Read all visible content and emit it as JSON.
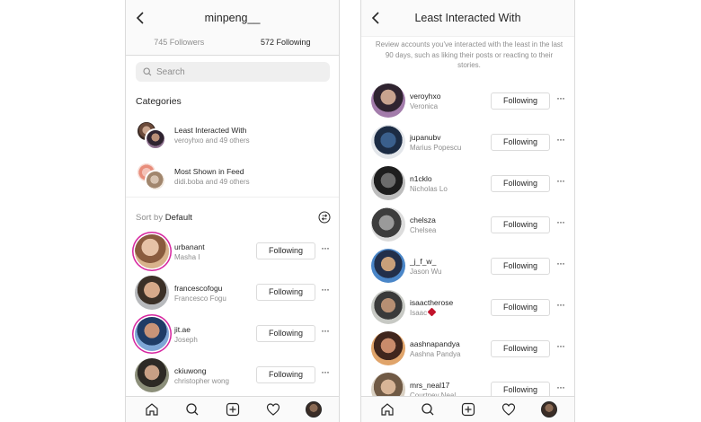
{
  "left": {
    "header": {
      "title": "minpeng__"
    },
    "tabs": [
      {
        "label": "745 Followers",
        "active": false
      },
      {
        "label": "572 Following",
        "active": true
      }
    ],
    "search": {
      "placeholder": "Search"
    },
    "categories_title": "Categories",
    "categories": [
      {
        "title": "Least Interacted With",
        "subtitle": "veroyhxo and 49 others"
      },
      {
        "title": "Most Shown in Feed",
        "subtitle": "didi.boba and 49 others"
      }
    ],
    "sort": {
      "prefix": "Sort by",
      "value": "Default"
    },
    "users": [
      {
        "username": "urbanant",
        "name": "Masha I",
        "button": "Following",
        "ring": true
      },
      {
        "username": "francescofogu",
        "name": "Francesco Fogu",
        "button": "Following",
        "ring": false
      },
      {
        "username": "jit.ae",
        "name": "Joseph",
        "button": "Following",
        "ring": true
      },
      {
        "username": "ckiuwong",
        "name": "christopher wong",
        "button": "Following",
        "ring": false
      }
    ]
  },
  "right": {
    "header": {
      "title": "Least Interacted With"
    },
    "description": "Review accounts you've interacted with the least in the last 90 days, such as liking their posts or reacting to their stories.",
    "users": [
      {
        "username": "veroyhxo",
        "name": "Veronica",
        "button": "Following"
      },
      {
        "username": "jupanubv",
        "name": "Marius Popescu",
        "button": "Following"
      },
      {
        "username": "n1cklo",
        "name": "Nicholas Lo",
        "button": "Following"
      },
      {
        "username": "chelsza",
        "name": "Chelsea",
        "button": "Following"
      },
      {
        "username": "_j_f_w_",
        "name": "Jason Wu",
        "button": "Following"
      },
      {
        "username": "isaactherose",
        "name": "Isaac",
        "button": "Following"
      },
      {
        "username": "aashnapandya",
        "name": "Aashna Pandya",
        "button": "Following"
      },
      {
        "username": "mrs_neal17",
        "name": "Courtney Neal",
        "button": "Following"
      }
    ]
  },
  "colors": {
    "ring": "#d6249f",
    "border": "#dbdbdb",
    "muted": "#8e8e8e",
    "text": "#262626"
  },
  "nav_icons": [
    "home-icon",
    "search-icon",
    "add-icon",
    "heart-icon",
    "profile-avatar"
  ]
}
